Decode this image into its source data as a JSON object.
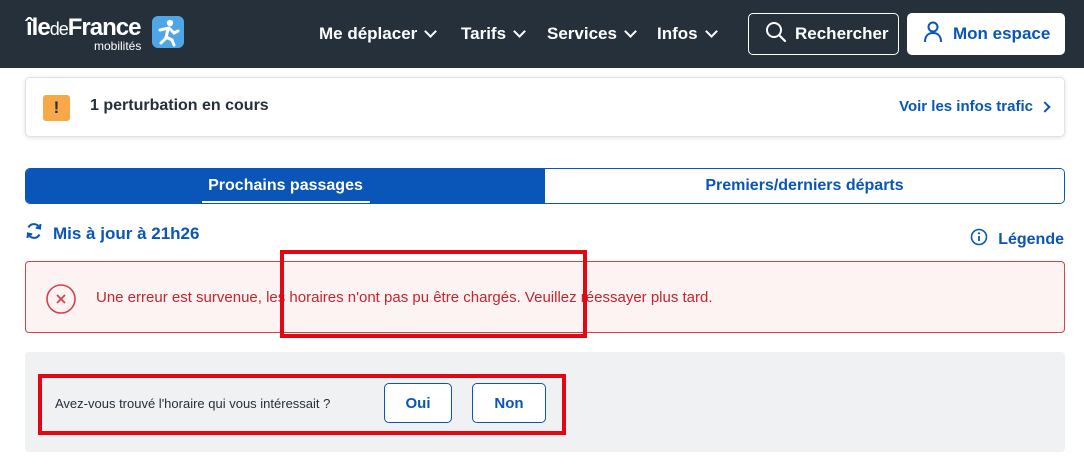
{
  "header": {
    "logo": {
      "brand": "îledeFrance",
      "brand_ile": "île",
      "brand_de": "de",
      "brand_france": "France",
      "subtitle": "mobilités"
    },
    "nav": [
      {
        "label": "Me déplacer"
      },
      {
        "label": "Tarifs"
      },
      {
        "label": "Services"
      },
      {
        "label": "Infos"
      }
    ],
    "search_label": "Rechercher",
    "account_label": "Mon espace"
  },
  "disruption": {
    "icon": "!",
    "text": "1 perturbation en cours",
    "link": "Voir les infos trafic"
  },
  "tabs": [
    {
      "label": "Prochains passages",
      "active": true
    },
    {
      "label": "Premiers/derniers départs",
      "active": false
    }
  ],
  "updated": {
    "label": "Mis à jour à 21h26"
  },
  "legend": {
    "label": "Légende"
  },
  "error": {
    "message": "Une erreur est survenue, les horaires n'ont pas pu être chargés. Veuillez réessayer plus tard."
  },
  "feedback": {
    "question": "Avez-vous trouvé l'horaire qui vous intéressait ?",
    "yes": "Oui",
    "no": "Non"
  },
  "colors": {
    "header_bg": "#25303b",
    "primary": "#0a55b8",
    "error": "#c8242c",
    "warning": "#f7a94a",
    "annotation": "#e30613"
  }
}
